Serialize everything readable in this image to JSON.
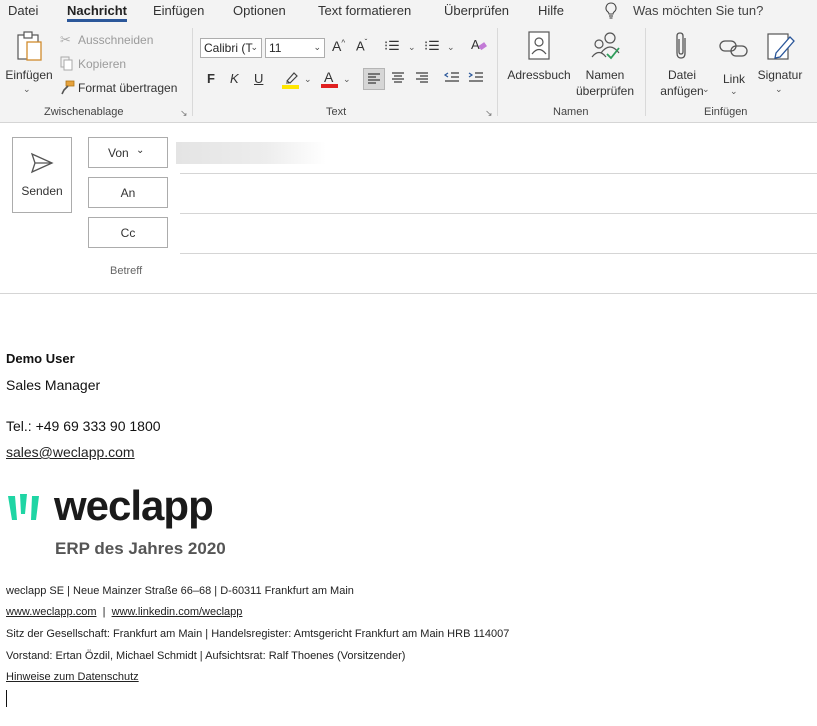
{
  "tabs": [
    {
      "label": "Datei"
    },
    {
      "label": "Nachricht"
    },
    {
      "label": "Einfügen"
    },
    {
      "label": "Optionen"
    },
    {
      "label": "Text formatieren"
    },
    {
      "label": "Überprüfen"
    },
    {
      "label": "Hilfe"
    }
  ],
  "search": {
    "placeholder": "Was möchten Sie tun?"
  },
  "ribbon": {
    "clipboard": {
      "paste_label": "Einfügen",
      "cut_label": "Ausschneiden",
      "copy_label": "Kopieren",
      "format_painter_label": "Format übertragen",
      "group_label": "Zwischenablage"
    },
    "text": {
      "font_name": "Calibri (T",
      "font_size": "11",
      "bold": "F",
      "italic": "K",
      "underline": "U",
      "group_label": "Text"
    },
    "names": {
      "address_book_label": "Adressbuch",
      "check_names_line1": "Namen",
      "check_names_line2": "überprüfen",
      "group_label": "Namen"
    },
    "include": {
      "attach_file_line1": "Datei",
      "attach_file_line2": "anfügen",
      "link_label": "Link",
      "signature_label": "Signatur",
      "group_label": "Einfügen"
    }
  },
  "header": {
    "send_label": "Senden",
    "from_label": "Von",
    "to_label": "An",
    "cc_label": "Cc",
    "subject_label": "Betreff"
  },
  "signature": {
    "name": "Demo User",
    "title": "Sales Manager",
    "phone": "Tel.: +49 69 333 90 1800",
    "email": "sales@weclapp.com",
    "logo_wordmark": "weclapp",
    "logo_tagline": "ERP des Jahres 2020",
    "address": "weclapp SE  |  Neue Mainzer Straße 66–68  |  D-60311 Frankfurt am Main",
    "website": "www.weclapp.com",
    "separator": "  |  ",
    "linkedin": "www.linkedin.com/weclapp",
    "registry": "Sitz der Gesellschaft: Frankfurt am Main  |  Handelsregister: Amtsgericht Frankfurt am Main HRB 114007",
    "board": "Vorstand: Ertan Özdil, Michael Schmidt  |  Aufsichtsrat: Ralf Thoenes (Vorsitzender)",
    "privacy": "Hinweise zum Datenschutz"
  },
  "colors": {
    "accent": "#2b579a",
    "logo_green": "#1fd5a4",
    "logo_dark": "#1a1a1a",
    "highlight_yellow": "#ffe600",
    "font_red": "#e02020"
  }
}
